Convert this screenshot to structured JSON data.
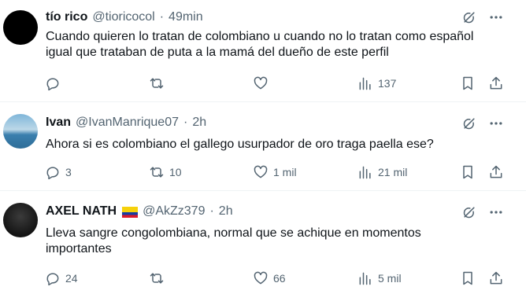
{
  "tweets": [
    {
      "name": "tío rico",
      "handle": "@tioricocol",
      "dot": "·",
      "time": "49min",
      "text": "Cuando quieren lo tratan de colombiano u cuando no lo tratan como español igual que trataban de puta a la mamá del dueño de este perfil",
      "replies": "",
      "retweets": "",
      "likes": "",
      "views": "137"
    },
    {
      "name": "Ivan",
      "handle": "@IvanManrique07",
      "dot": "·",
      "time": "2h",
      "text": "Ahora si es colombiano el gallego usurpador de oro traga paella ese?",
      "replies": "3",
      "retweets": "10",
      "likes": "1 mil",
      "views": "21 mil"
    },
    {
      "name": "AXEL NATH",
      "flag": "ecuador-flag-emoji",
      "handle": "@AkZz379",
      "dot": "·",
      "time": "2h",
      "text": "Lleva sangre congolombiana, normal que se achique en momentos importantes",
      "replies": "24",
      "retweets": "",
      "likes": "66",
      "views": "5 mil"
    }
  ],
  "icons": {
    "top": [
      "grok-icon",
      "more-icon"
    ],
    "actions": [
      "reply-icon",
      "retweet-icon",
      "like-icon",
      "views-icon",
      "bookmark-icon",
      "share-icon"
    ]
  },
  "colors": {
    "text": "#0f1419",
    "secondary": "#536471",
    "divider": "#eff3f4"
  }
}
